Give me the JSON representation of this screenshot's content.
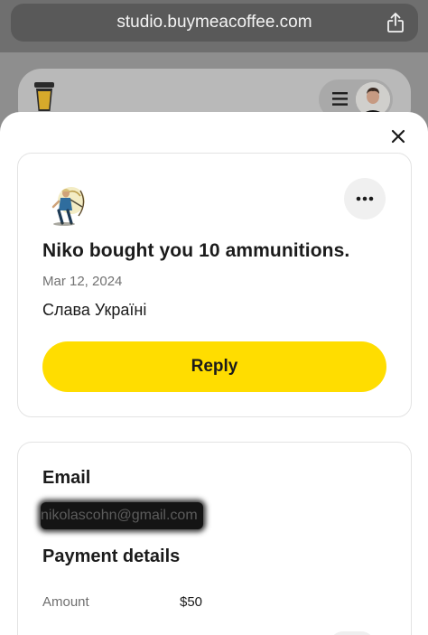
{
  "browser": {
    "url": "studio.buymeacoffee.com",
    "share_icon": "share-icon"
  },
  "background_header": {
    "logo_icon": "coffee-cup-icon",
    "menu_icon": "hamburger-icon"
  },
  "modal": {
    "close_icon": "close-icon",
    "support": {
      "title": "Niko bought you 10 ammunitions.",
      "date": "Mar 12, 2024",
      "message": "Слава Україні",
      "reply_label": "Reply",
      "more_icon": "ellipsis-icon"
    },
    "details": {
      "email_heading": "Email",
      "email_value": "nikolascohn@gmail.com",
      "payment_heading": "Payment details",
      "amount_label": "Amount",
      "amount_value": "$50"
    }
  },
  "colors": {
    "accent_yellow": "#ffdd00",
    "overlay": "#8e8e8e",
    "sheet": "#ffffff"
  }
}
